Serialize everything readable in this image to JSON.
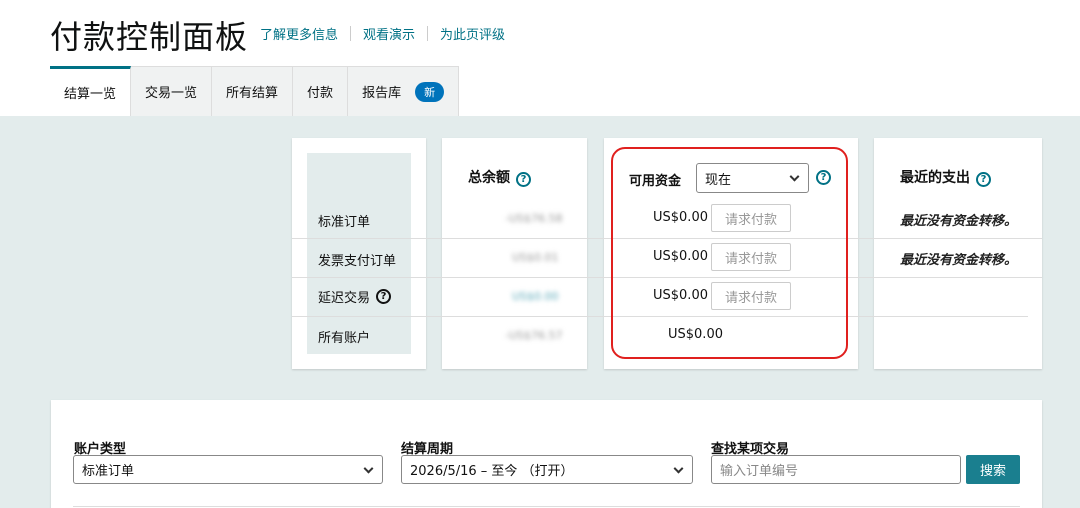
{
  "header": {
    "title": "付款控制面板",
    "links": [
      "了解更多信息",
      "观看演示",
      "为此页评级"
    ]
  },
  "tabs": [
    {
      "label": "结算一览",
      "active": true
    },
    {
      "label": "交易一览"
    },
    {
      "label": "所有结算"
    },
    {
      "label": "付款"
    },
    {
      "label": "报告库",
      "badge": "新"
    }
  ],
  "summary": {
    "row_labels": [
      "标准订单",
      "发票支付订单",
      "延迟交易",
      "所有账户"
    ],
    "total_balance": {
      "heading": "总余额",
      "values": [
        "-US$76.58",
        "US$0.01",
        "US$0.00",
        "-US$76.57"
      ]
    },
    "available_funds": {
      "heading": "可用资金",
      "period_select": "现在",
      "values": [
        "US$0.00",
        "US$0.00",
        "US$0.00",
        "US$0.00"
      ],
      "request_button_label": "请求付款"
    },
    "recent_disbursements": {
      "heading": "最近的支出",
      "messages": [
        "最近没有资金转移。",
        "最近没有资金转移。"
      ]
    }
  },
  "filters": {
    "account_type": {
      "label": "账户类型",
      "value": "标准订单"
    },
    "settlement_period": {
      "label": "结算周期",
      "value": "2026/5/16 – 至今 （打开）"
    },
    "find_transaction": {
      "label": "查找某项交易",
      "placeholder": "输入订单编号",
      "button": "搜索"
    }
  },
  "colors": {
    "accent": "#007185",
    "highlight": "#e0201e",
    "badge": "#0073bb",
    "search_button": "#1a7f8f"
  }
}
